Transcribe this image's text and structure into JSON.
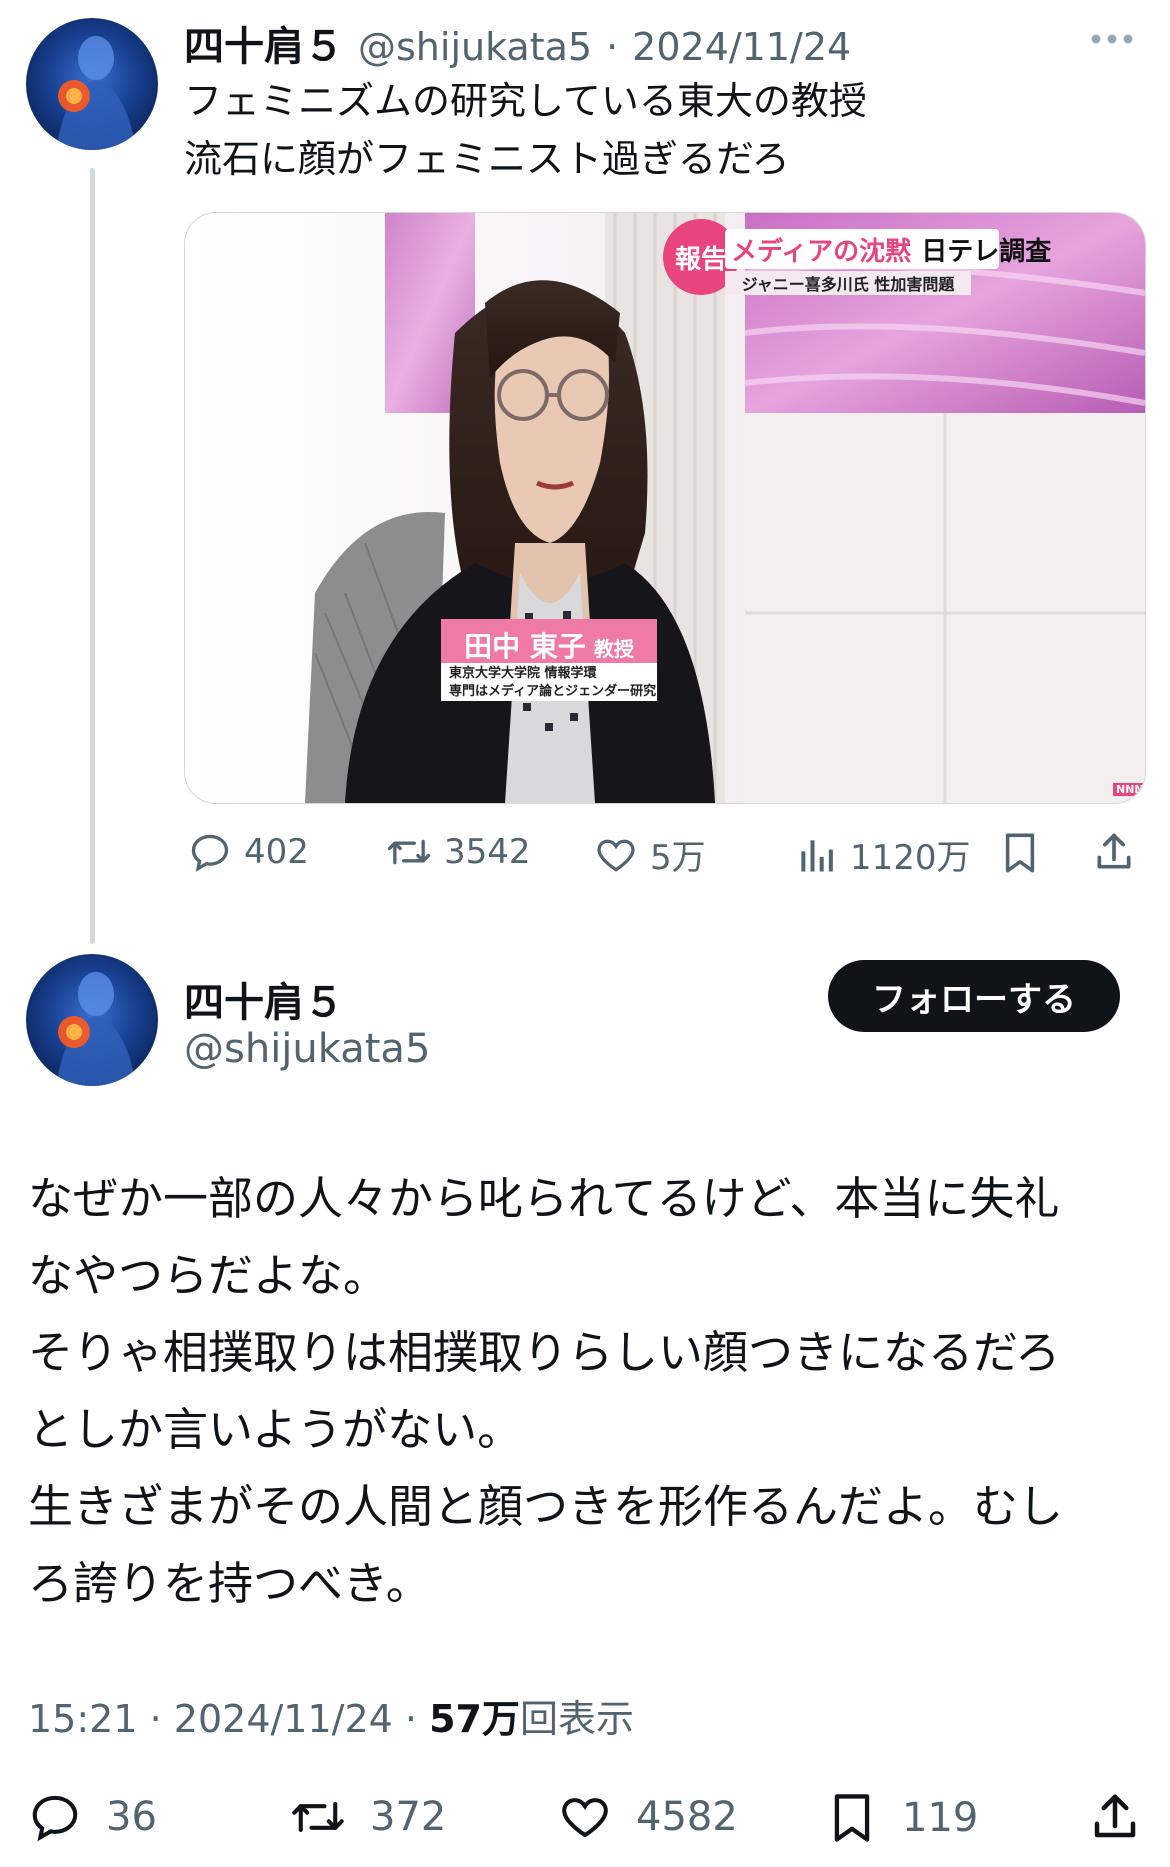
{
  "first_tweet": {
    "display_name": "四十肩５",
    "handle": "@shijukata5",
    "separator": "·",
    "date": "2024/11/24",
    "more_icon": "more-dots-icon",
    "text_line1": "フェミニズムの研究している東大の教授",
    "text_line2": "流石に顔がフェミニスト過ぎるだろ",
    "media": {
      "ticker_badge": "報告",
      "ticker_title": "メディアの沈黙",
      "ticker_channel": "日テレ調査",
      "ticker_sub": "ジャニー喜多川氏 性加害問題",
      "nameplate_name": "田中 東子",
      "nameplate_title": "教授",
      "nameplate_line1": "東京大学大学院 情報学環",
      "nameplate_line2": "専門はメディア論とジェンダー研究",
      "corner_logo": "NNN"
    },
    "actions": {
      "replies": "402",
      "reposts": "3542",
      "likes": "5万",
      "views": "1120万"
    }
  },
  "second_tweet": {
    "display_name": "四十肩５",
    "handle": "@shijukata5",
    "follow_label": "フォローする",
    "text": [
      "なぜか一部の人々から叱られてるけど、本当に失礼",
      "なやつらだよな。",
      "そりゃ相撲取りは相撲取りらしい顔つきになるだろ",
      "としか言いようがない。",
      "生きざまがその人間と顔つきを形作るんだよ。むし",
      "ろ誇りを持つべき。"
    ],
    "time": "15:21",
    "date": "2024/11/24",
    "separator": "·",
    "views_count": "57万",
    "views_label": "回表示",
    "actions": {
      "replies": "36",
      "reposts": "372",
      "likes": "4582",
      "bookmarks": "119"
    }
  },
  "colors": {
    "text_primary": "#0f1419",
    "text_secondary": "#536471",
    "thread_line": "#cfd9de",
    "follow_button_bg": "#0f1419",
    "ticker_pink": "#e8457f"
  }
}
